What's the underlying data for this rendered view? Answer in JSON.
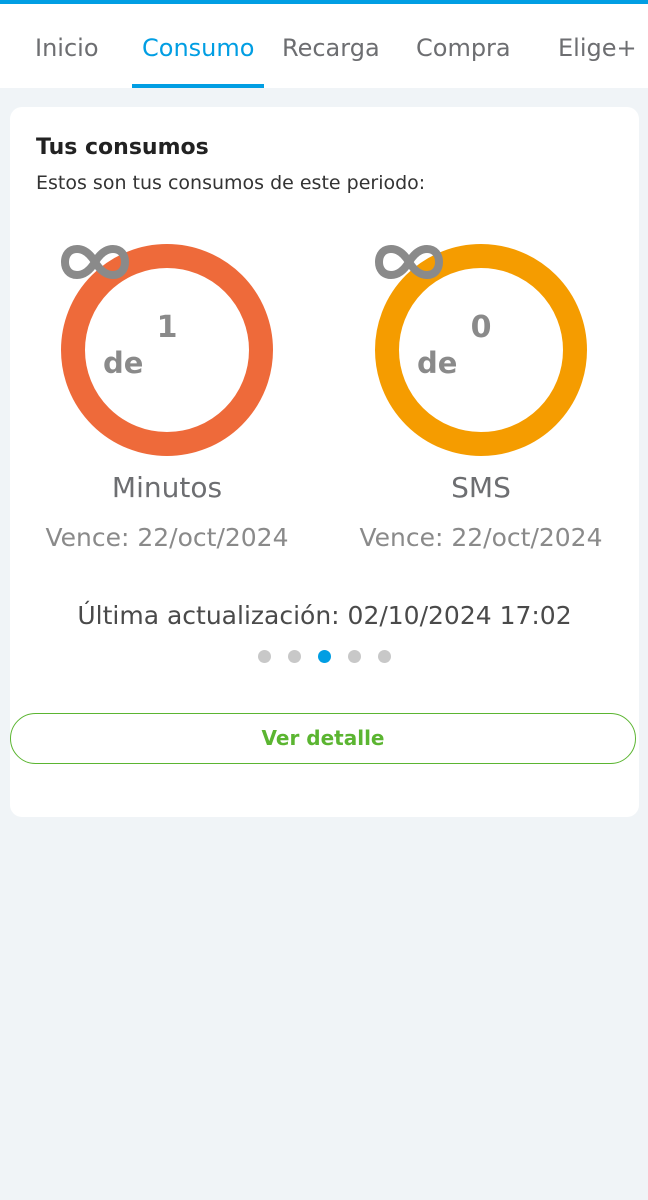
{
  "tabs": [
    {
      "label": "Inicio",
      "active": false
    },
    {
      "label": "Consumo",
      "active": true
    },
    {
      "label": "Recarga",
      "active": false
    },
    {
      "label": "Compra",
      "active": false
    },
    {
      "label": "Elige+",
      "active": false
    }
  ],
  "card": {
    "title": "Tus consumos",
    "subtitle": "Estos son tus consumos de este periodo:",
    "gauges": [
      {
        "value": "1",
        "of_label": "de",
        "limit_icon": "infinity-icon",
        "label": "Minutos",
        "expiry": "Vence: 22/oct/2024",
        "color": "#ee6a3a"
      },
      {
        "value": "0",
        "of_label": "de",
        "limit_icon": "infinity-icon",
        "label": "SMS",
        "expiry": "Vence: 22/oct/2024",
        "color": "#f59c00"
      }
    ],
    "last_update": "Última actualización: 02/10/2024 17:02",
    "pagination": {
      "total": 5,
      "active_index": 2
    }
  },
  "detail_button": {
    "label": "Ver detalle"
  },
  "colors": {
    "accent": "#019ee3",
    "button_green": "#5bb531",
    "background": "#f0f4f7"
  }
}
